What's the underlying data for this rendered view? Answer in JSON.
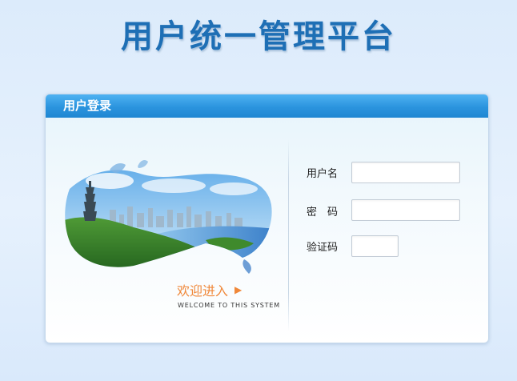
{
  "page": {
    "title": "用户统一管理平台"
  },
  "panel": {
    "header_title": "用户登录"
  },
  "welcome": {
    "text": "欢迎进入",
    "arrow": "▶",
    "subtitle": "WELCOME TO THIS SYSTEM"
  },
  "form": {
    "username_label": "用户名",
    "username_value": "",
    "password_label": "密　码",
    "password_value": "",
    "captcha_label": "验证码",
    "captcha_value": ""
  },
  "colors": {
    "title": "#1e6fb5",
    "header": "#2b94de",
    "accent": "#f0883a"
  }
}
